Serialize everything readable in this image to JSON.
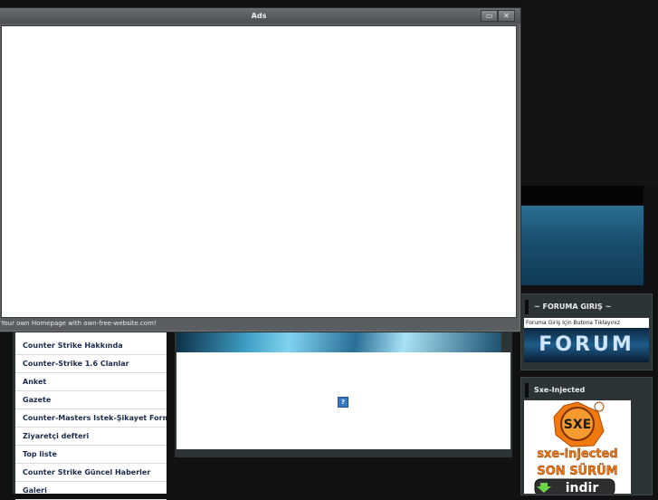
{
  "popup": {
    "title": "Ads",
    "footer_text": "Your own Homepage with own-free-website.com!",
    "minimize_icon": "minimize-icon",
    "close_icon": "close-icon",
    "minimize_label": "▭",
    "close_label": "✕"
  },
  "nav": {
    "items": [
      {
        "label": "Counter Strike Hakkında"
      },
      {
        "label": "Counter-Strike 1.6 Clanlar"
      },
      {
        "label": "Anket"
      },
      {
        "label": "Gazete"
      },
      {
        "label": "Counter-Masters Istek-Şikayet Formu"
      },
      {
        "label": "Ziyaretçi defteri"
      },
      {
        "label": "Top liste"
      },
      {
        "label": "Counter Strike Güncel Haberler"
      },
      {
        "label": "Galeri"
      }
    ]
  },
  "forum_box": {
    "title": "~ FORUMA GIRIŞ ~",
    "caption": "Foruma Giriş Için Butona Tıklayınız",
    "image_text": "FORUM"
  },
  "sxe_box": {
    "title": "Sxe-Injected",
    "logo_text": "SXE",
    "line1": "sxe-injected",
    "line2": "SON SÜRÜM",
    "download_label": "indir"
  },
  "center": {
    "broken_image_icon": "broken-image-icon",
    "broken_image_glyph": "?"
  },
  "colors": {
    "page_bg": "#111111",
    "panel": "#2c3436",
    "nav_text": "#1a2a4a",
    "sxe_orange": "#f07a10"
  }
}
